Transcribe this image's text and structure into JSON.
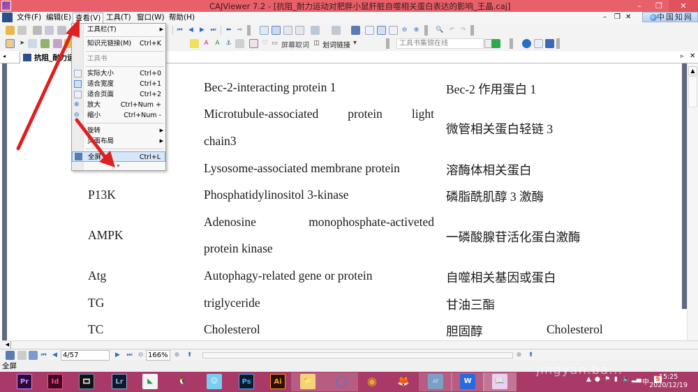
{
  "window": {
    "title": "CAJViewer 7.2 - [抗阻_耐力运动对肥胖小鼠肝脏自噬相关蛋白表达的影响_王晶.caj]",
    "minimize": "–",
    "restore": "❐",
    "close": "✕"
  },
  "menubar": {
    "items": [
      "文件(F)",
      "编辑(E)",
      "查看(V)",
      "工具(T)",
      "窗口(W)",
      "帮助(H)"
    ],
    "active_index": 2,
    "mdi_controls": [
      "–",
      "❐",
      "✕"
    ],
    "cnki_label": "中国知网"
  },
  "toolbar2": {
    "screen_word_lookup": "屏幕取词",
    "word_link": "划词链接",
    "toolbook_placeholder": "工具书集锦在线"
  },
  "tab": {
    "doc_label": "抗阻_耐力运"
  },
  "view_menu": {
    "items": [
      {
        "label": "工具栏(T)",
        "shortcut": "",
        "submenu": true,
        "disabled": false,
        "icon": ""
      },
      {
        "label": "知识元链接(M)",
        "shortcut": "Ctrl+K",
        "submenu": false,
        "disabled": false,
        "icon": ""
      },
      {
        "label": "工具书",
        "shortcut": "",
        "submenu": false,
        "disabled": true,
        "icon": ""
      },
      {
        "label": "实际大小",
        "shortcut": "Ctrl+0",
        "submenu": false,
        "disabled": false,
        "icon": "page-icon"
      },
      {
        "label": "适合宽度",
        "shortcut": "Ctrl+1",
        "submenu": false,
        "disabled": false,
        "icon": "fit-width-icon"
      },
      {
        "label": "适合页面",
        "shortcut": "Ctrl+2",
        "submenu": false,
        "disabled": false,
        "icon": "fit-page-icon"
      },
      {
        "label": "放大",
        "shortcut": "Ctrl+Num +",
        "submenu": false,
        "disabled": false,
        "icon": "zoom-in-icon"
      },
      {
        "label": "缩小",
        "shortcut": "Ctrl+Num -",
        "submenu": false,
        "disabled": false,
        "icon": "zoom-out-icon"
      },
      {
        "label": "旋转",
        "shortcut": "",
        "submenu": true,
        "disabled": false,
        "icon": ""
      },
      {
        "label": "页面布局",
        "shortcut": "",
        "submenu": true,
        "disabled": false,
        "icon": ""
      },
      {
        "label": "全屏",
        "shortcut": "Ctrl+L",
        "submenu": false,
        "disabled": false,
        "icon": "fullscreen-icon",
        "highlighted": true
      }
    ],
    "expand_glyph": "»"
  },
  "document": {
    "rows": [
      {
        "abbr": "",
        "english": [
          "Bec-2-interacting protein 1"
        ],
        "chinese": "Bec-2 作用蛋白 1"
      },
      {
        "abbr": "",
        "english": [
          "Microtubule-associated protein light",
          "chain3"
        ],
        "chinese": "微管相关蛋白轻链 3"
      },
      {
        "abbr": "",
        "english": [
          "Lysosome-associated membrane protein"
        ],
        "chinese": "溶酶体相关蛋白"
      },
      {
        "abbr": "P13K",
        "english": [
          "Phosphatidylinositol 3-kinase"
        ],
        "chinese": "磷脂酰肌醇 3 激酶"
      },
      {
        "abbr": "AMPK",
        "english": [
          "Adenosine monophosphate-activeted",
          "protein kinase"
        ],
        "chinese": "一磷酸腺苷活化蛋白激酶"
      },
      {
        "abbr": "Atg",
        "english": [
          "Autophagy-related gene or protein"
        ],
        "chinese": "自噬相关基因或蛋白"
      },
      {
        "abbr": "TG",
        "english": [
          "triglyceride"
        ],
        "chinese": "甘油三酯"
      },
      {
        "abbr": "TC",
        "english": [
          "Cholesterol"
        ],
        "chinese": "胆固醇"
      }
    ],
    "overflow_text": "Cholesterol"
  },
  "navbar": {
    "page_value": "4/57",
    "zoom_value": "166%"
  },
  "statusbar": {
    "text": "全屏"
  },
  "taskbar": {
    "apps": [
      "Pr",
      "Id",
      "🎞",
      "Lr",
      "◣",
      "🐧",
      "☺",
      "Ps",
      "Ai",
      "📁",
      "◯",
      "◉",
      "🦊",
      "▱",
      "W",
      "📖"
    ],
    "clock_time": "15:25",
    "clock_date": "2020/12/19",
    "ime": "中",
    "watermark": "jingyan.ba..."
  },
  "colors": {
    "titlebar": "#e8606a",
    "taskbar": "#a93a67",
    "menu_highlight": "#d5e6f8",
    "annotation_arrow": "#e02020"
  }
}
